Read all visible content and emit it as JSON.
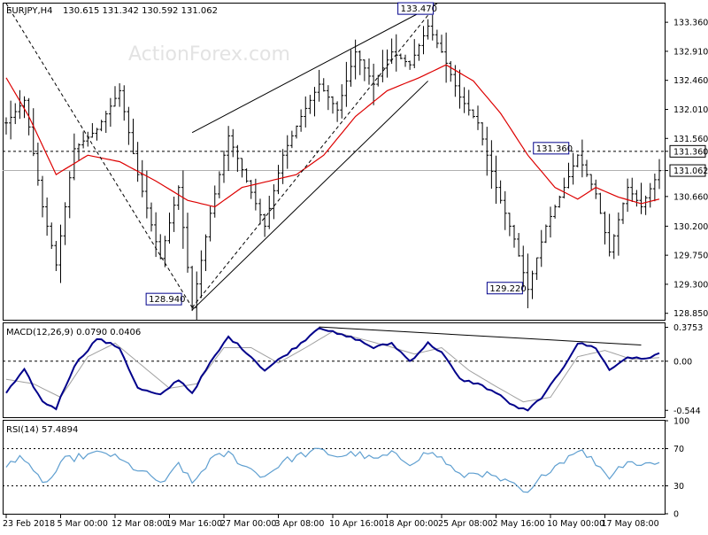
{
  "header": {
    "symbol": "EURJPY,H4",
    "ohlc": "130.615 131.342 130.592 131.062"
  },
  "watermark": "ActionForex.com",
  "colors": {
    "bar": "#000000",
    "sma": "#dd0000",
    "macd_main": "#00008b",
    "macd_signal": "#a0a0a0",
    "rsi": "#5f9fd0",
    "grid": "#000000",
    "watermark": "#e3e3e3"
  },
  "chart_data": [
    {
      "type": "ohlc",
      "name": "price",
      "ylim": [
        128.75,
        133.65
      ],
      "y_ticks": [
        "133.360",
        "132.910",
        "132.460",
        "132.010",
        "131.560",
        "131.360",
        "131.062",
        "130.660",
        "130.200",
        "129.750",
        "129.300",
        "128.850"
      ],
      "price_highlights": {
        "current": "131.062",
        "horizontal_line": "131.360"
      },
      "annotations": [
        "133.470",
        "131.360",
        "129.220",
        "128.940"
      ],
      "trendlines": [
        {
          "style": "solid",
          "from": {
            "index": 41,
            "value": 131.65
          },
          "to": {
            "index": 95,
            "value": 133.65
          }
        },
        {
          "style": "solid",
          "from": {
            "index": 41,
            "value": 128.9
          },
          "to": {
            "index": 93,
            "value": 132.45
          }
        },
        {
          "style": "dashed",
          "from": {
            "index": 0,
            "value": 133.65
          },
          "to": {
            "index": 41,
            "value": 128.94
          }
        },
        {
          "style": "dashed",
          "from": {
            "index": 41,
            "value": 128.94
          },
          "to": {
            "index": 93,
            "value": 133.47
          }
        }
      ],
      "key_points": [
        {
          "index": 0,
          "value": 131.8
        },
        {
          "index": 4,
          "value": 132.15
        },
        {
          "index": 8,
          "value": 130.5
        },
        {
          "index": 11,
          "value": 129.6
        },
        {
          "index": 15,
          "value": 131.4
        },
        {
          "index": 20,
          "value": 131.7
        },
        {
          "index": 25,
          "value": 132.3
        },
        {
          "index": 29,
          "value": 131.0
        },
        {
          "index": 34,
          "value": 129.7
        },
        {
          "index": 38,
          "value": 130.8
        },
        {
          "index": 41,
          "value": 128.94
        },
        {
          "index": 45,
          "value": 130.4
        },
        {
          "index": 49,
          "value": 131.6
        },
        {
          "index": 53,
          "value": 130.9
        },
        {
          "index": 57,
          "value": 130.2
        },
        {
          "index": 61,
          "value": 131.3
        },
        {
          "index": 65,
          "value": 131.9
        },
        {
          "index": 69,
          "value": 132.4
        },
        {
          "index": 73,
          "value": 132.0
        },
        {
          "index": 77,
          "value": 132.9
        },
        {
          "index": 81,
          "value": 132.4
        },
        {
          "index": 85,
          "value": 132.9
        },
        {
          "index": 89,
          "value": 132.7
        },
        {
          "index": 93,
          "value": 133.3
        },
        {
          "index": 96,
          "value": 132.9
        },
        {
          "index": 100,
          "value": 132.2
        },
        {
          "index": 104,
          "value": 131.8
        },
        {
          "index": 108,
          "value": 130.8
        },
        {
          "index": 112,
          "value": 130.0
        },
        {
          "index": 115,
          "value": 129.22
        },
        {
          "index": 119,
          "value": 130.2
        },
        {
          "index": 123,
          "value": 130.8
        },
        {
          "index": 126,
          "value": 131.3
        },
        {
          "index": 130,
          "value": 130.7
        },
        {
          "index": 133,
          "value": 129.8
        },
        {
          "index": 137,
          "value": 130.8
        },
        {
          "index": 140,
          "value": 130.5
        },
        {
          "index": 144,
          "value": 131.06
        }
      ],
      "sma_key_points": [
        {
          "index": 0,
          "value": 132.5
        },
        {
          "index": 5,
          "value": 131.9
        },
        {
          "index": 11,
          "value": 131.0
        },
        {
          "index": 18,
          "value": 131.3
        },
        {
          "index": 25,
          "value": 131.2
        },
        {
          "index": 33,
          "value": 130.9
        },
        {
          "index": 40,
          "value": 130.6
        },
        {
          "index": 46,
          "value": 130.5
        },
        {
          "index": 52,
          "value": 130.8
        },
        {
          "index": 58,
          "value": 130.9
        },
        {
          "index": 64,
          "value": 131.0
        },
        {
          "index": 70,
          "value": 131.3
        },
        {
          "index": 77,
          "value": 131.9
        },
        {
          "index": 84,
          "value": 132.3
        },
        {
          "index": 91,
          "value": 132.5
        },
        {
          "index": 97,
          "value": 132.7
        },
        {
          "index": 103,
          "value": 132.45
        },
        {
          "index": 109,
          "value": 131.95
        },
        {
          "index": 115,
          "value": 131.3
        },
        {
          "index": 121,
          "value": 130.8
        },
        {
          "index": 126,
          "value": 130.62
        },
        {
          "index": 130,
          "value": 130.8
        },
        {
          "index": 135,
          "value": 130.65
        },
        {
          "index": 140,
          "value": 130.55
        },
        {
          "index": 144,
          "value": 130.62
        }
      ]
    },
    {
      "type": "line",
      "name": "macd",
      "label": "MACD(12,26,9) 0.0790 0.0406",
      "ylim": [
        -0.62,
        0.42
      ],
      "y_ticks": [
        "0.3753",
        "0.00",
        "-0.544"
      ],
      "main_key_points": [
        {
          "index": 0,
          "value": -0.35
        },
        {
          "index": 4,
          "value": -0.1
        },
        {
          "index": 8,
          "value": -0.45
        },
        {
          "index": 11,
          "value": -0.52
        },
        {
          "index": 15,
          "value": -0.05
        },
        {
          "index": 20,
          "value": 0.25
        },
        {
          "index": 25,
          "value": 0.15
        },
        {
          "index": 29,
          "value": -0.3
        },
        {
          "index": 34,
          "value": -0.38
        },
        {
          "index": 38,
          "value": -0.2
        },
        {
          "index": 41,
          "value": -0.35
        },
        {
          "index": 45,
          "value": -0.02
        },
        {
          "index": 49,
          "value": 0.27
        },
        {
          "index": 53,
          "value": 0.1
        },
        {
          "index": 57,
          "value": -0.1
        },
        {
          "index": 61,
          "value": 0.05
        },
        {
          "index": 65,
          "value": 0.2
        },
        {
          "index": 69,
          "value": 0.38
        },
        {
          "index": 73,
          "value": 0.3
        },
        {
          "index": 77,
          "value": 0.25
        },
        {
          "index": 81,
          "value": 0.15
        },
        {
          "index": 85,
          "value": 0.2
        },
        {
          "index": 89,
          "value": 0.0
        },
        {
          "index": 93,
          "value": 0.2
        },
        {
          "index": 96,
          "value": 0.1
        },
        {
          "index": 100,
          "value": -0.2
        },
        {
          "index": 104,
          "value": -0.25
        },
        {
          "index": 108,
          "value": -0.35
        },
        {
          "index": 112,
          "value": -0.5
        },
        {
          "index": 115,
          "value": -0.55
        },
        {
          "index": 119,
          "value": -0.35
        },
        {
          "index": 123,
          "value": -0.05
        },
        {
          "index": 126,
          "value": 0.2
        },
        {
          "index": 130,
          "value": 0.15
        },
        {
          "index": 133,
          "value": -0.1
        },
        {
          "index": 137,
          "value": 0.05
        },
        {
          "index": 140,
          "value": 0.02
        },
        {
          "index": 144,
          "value": 0.08
        }
      ],
      "signal_key_points": [
        {
          "index": 0,
          "value": -0.2
        },
        {
          "index": 6,
          "value": -0.25
        },
        {
          "index": 12,
          "value": -0.4
        },
        {
          "index": 18,
          "value": 0.05
        },
        {
          "index": 24,
          "value": 0.2
        },
        {
          "index": 30,
          "value": -0.05
        },
        {
          "index": 36,
          "value": -0.3
        },
        {
          "index": 42,
          "value": -0.25
        },
        {
          "index": 48,
          "value": 0.15
        },
        {
          "index": 54,
          "value": 0.15
        },
        {
          "index": 60,
          "value": -0.02
        },
        {
          "index": 66,
          "value": 0.15
        },
        {
          "index": 72,
          "value": 0.33
        },
        {
          "index": 78,
          "value": 0.25
        },
        {
          "index": 84,
          "value": 0.17
        },
        {
          "index": 90,
          "value": 0.08
        },
        {
          "index": 96,
          "value": 0.15
        },
        {
          "index": 102,
          "value": -0.1
        },
        {
          "index": 108,
          "value": -0.28
        },
        {
          "index": 114,
          "value": -0.45
        },
        {
          "index": 120,
          "value": -0.4
        },
        {
          "index": 126,
          "value": 0.05
        },
        {
          "index": 132,
          "value": 0.12
        },
        {
          "index": 138,
          "value": 0.02
        },
        {
          "index": 144,
          "value": 0.04
        }
      ],
      "trendline": {
        "style": "solid",
        "from": {
          "index": 69,
          "value": 0.38
        },
        "to": {
          "index": 140,
          "value": 0.18
        }
      }
    },
    {
      "type": "line",
      "name": "rsi",
      "label": "RSI(14) 57.4894",
      "ylim": [
        0,
        100
      ],
      "y_ticks": [
        "100",
        "70",
        "30",
        "0"
      ],
      "levels": [
        70,
        30
      ],
      "key_points": [
        {
          "index": 0,
          "value": 50
        },
        {
          "index": 3,
          "value": 64
        },
        {
          "index": 6,
          "value": 43
        },
        {
          "index": 9,
          "value": 33
        },
        {
          "index": 13,
          "value": 58
        },
        {
          "index": 17,
          "value": 62
        },
        {
          "index": 22,
          "value": 66
        },
        {
          "index": 26,
          "value": 55
        },
        {
          "index": 31,
          "value": 42
        },
        {
          "index": 35,
          "value": 32
        },
        {
          "index": 38,
          "value": 55
        },
        {
          "index": 41,
          "value": 32
        },
        {
          "index": 45,
          "value": 58
        },
        {
          "index": 49,
          "value": 65
        },
        {
          "index": 53,
          "value": 50
        },
        {
          "index": 57,
          "value": 40
        },
        {
          "index": 61,
          "value": 56
        },
        {
          "index": 65,
          "value": 63
        },
        {
          "index": 69,
          "value": 68
        },
        {
          "index": 73,
          "value": 62
        },
        {
          "index": 77,
          "value": 65
        },
        {
          "index": 81,
          "value": 58
        },
        {
          "index": 85,
          "value": 64
        },
        {
          "index": 89,
          "value": 55
        },
        {
          "index": 93,
          "value": 66
        },
        {
          "index": 96,
          "value": 60
        },
        {
          "index": 100,
          "value": 40
        },
        {
          "index": 104,
          "value": 45
        },
        {
          "index": 108,
          "value": 38
        },
        {
          "index": 112,
          "value": 30
        },
        {
          "index": 115,
          "value": 20
        },
        {
          "index": 119,
          "value": 45
        },
        {
          "index": 123,
          "value": 58
        },
        {
          "index": 126,
          "value": 70
        },
        {
          "index": 130,
          "value": 55
        },
        {
          "index": 133,
          "value": 40
        },
        {
          "index": 137,
          "value": 58
        },
        {
          "index": 140,
          "value": 52
        },
        {
          "index": 144,
          "value": 57
        }
      ]
    }
  ],
  "x_axis": {
    "bar_count": 145,
    "labels": [
      {
        "index": 0,
        "text": "23 Feb 2018"
      },
      {
        "index": 12,
        "text": "5 Mar 00:00"
      },
      {
        "index": 24,
        "text": "12 Mar 08:00"
      },
      {
        "index": 36,
        "text": "19 Mar 16:00"
      },
      {
        "index": 48,
        "text": "27 Mar 00:00"
      },
      {
        "index": 60,
        "text": "3 Apr 08:00"
      },
      {
        "index": 72,
        "text": "10 Apr 16:00"
      },
      {
        "index": 84,
        "text": "18 Apr 00:00"
      },
      {
        "index": 96,
        "text": "25 Apr 08:00"
      },
      {
        "index": 108,
        "text": "2 May 16:00"
      },
      {
        "index": 120,
        "text": "10 May 00:00"
      },
      {
        "index": 132,
        "text": "17 May 08:00"
      }
    ]
  }
}
